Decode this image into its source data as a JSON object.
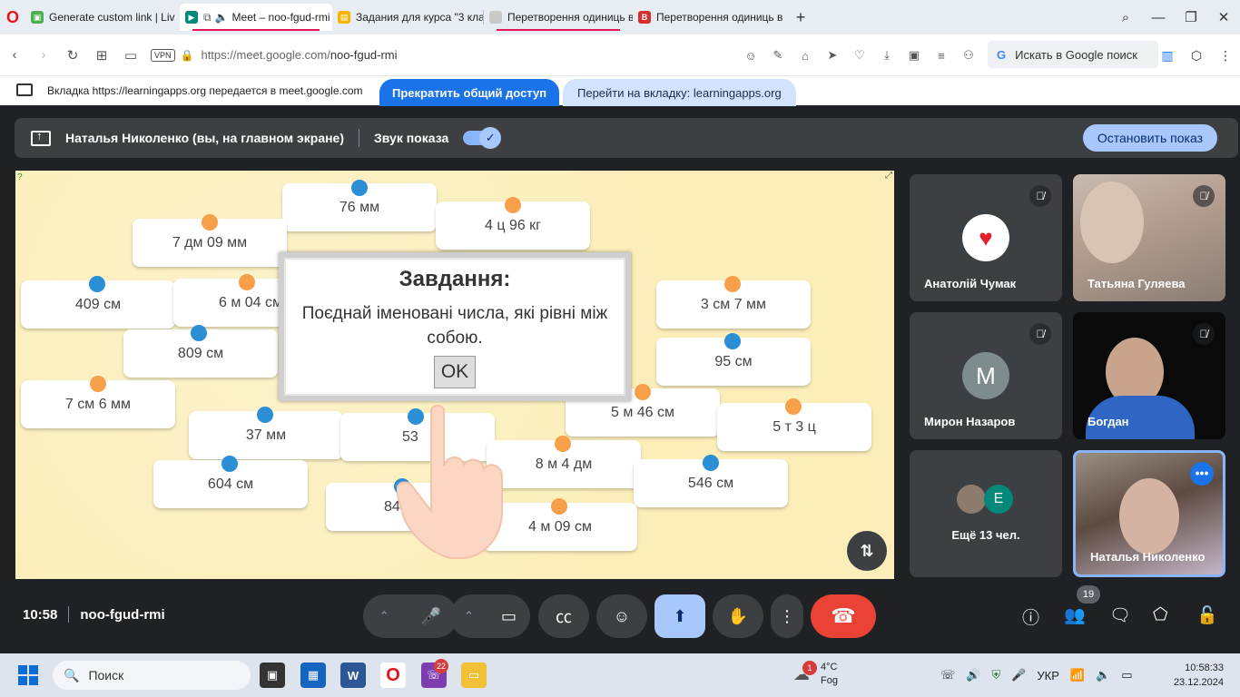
{
  "browser": {
    "tabs": [
      {
        "title": "Generate custom link | Liv",
        "favicon_color": "#4caf50"
      },
      {
        "title": "Meet – noo-fgud-rmi",
        "favicon_color": "#00897b",
        "active": true
      },
      {
        "title": "Задания для курса \"3 кла",
        "favicon_color": "#f4b400"
      },
      {
        "title": "Перетворення одиниць в",
        "favicon_color": "#c9c9c9"
      },
      {
        "title": "Перетворення одиниць в",
        "favicon_color": "#d32f2f",
        "favicon_letter": "B"
      }
    ],
    "new_tab": "+",
    "vpn": "VPN",
    "url_host": "https://meet.google.com/",
    "url_path": "noo-fgud-rmi",
    "search_placeholder": "Искать в Google поиск",
    "search_g": "G"
  },
  "share_bar": {
    "message": "Вкладка https://learningapps.org передается в meet.google.com",
    "stop_button": "Прекратить общий доступ",
    "goto_button": "Перейти на вкладку: learningapps.org"
  },
  "presenter": {
    "name": "Наталья Николенко (вы, на главном экране)",
    "sound_label": "Звук показа",
    "toggle_mark": "✓",
    "stop_button": "Остановить показ"
  },
  "stage": {
    "cards": [
      {
        "label": "76 мм",
        "dot": "b"
      },
      {
        "label": "4 ц 96 кг",
        "dot": "o"
      },
      {
        "label": "7 дм 09 мм",
        "dot": "o"
      },
      {
        "label": "409 см",
        "dot": "b"
      },
      {
        "label": "6 м 04 см",
        "dot": "o"
      },
      {
        "label": "3 см 7 мм",
        "dot": "o"
      },
      {
        "label": "809 см",
        "dot": "b"
      },
      {
        "label": "95 см",
        "dot": "b"
      },
      {
        "label": "7 см 6 мм",
        "dot": "o"
      },
      {
        "label": "5 м 46 см",
        "dot": "o"
      },
      {
        "label": "5 т 3 ц",
        "dot": "o"
      },
      {
        "label": "37 мм",
        "dot": "b"
      },
      {
        "label": "53",
        "dot": "b"
      },
      {
        "label": "8 м 4 дм",
        "dot": "o"
      },
      {
        "label": "604 см",
        "dot": "b"
      },
      {
        "label": "546 см",
        "dot": "b"
      },
      {
        "label": "84 дм",
        "dot": "b"
      },
      {
        "label": "4 м 09 см",
        "dot": "o"
      }
    ],
    "dialog_title": "Завдання:",
    "dialog_text": "Поєднай іменовані числа, які рівні між собою.",
    "dialog_ok": "OK",
    "swap_icon": "⇅"
  },
  "participants": [
    {
      "name": "Анатолій Чумак",
      "muted": true,
      "avatar": "heart"
    },
    {
      "name": "Татьяна Гуляева",
      "muted": true,
      "avatar": "video"
    },
    {
      "name": "Мирон Назаров",
      "muted": true,
      "avatar": "M"
    },
    {
      "name": "Богдан",
      "muted": true,
      "avatar": "video"
    },
    {
      "name": "Ещё 13 чел.",
      "avatar": "group",
      "group_letter": "E"
    },
    {
      "name": "Наталья Николенко",
      "avatar": "video"
    }
  ],
  "mute_icon": "🎙̸",
  "more_icon": "•••",
  "bottom": {
    "time": "10:58",
    "meeting_code": "noo-fgud-rmi",
    "participants_count": "19",
    "hangup_icon": "☎"
  },
  "taskbar": {
    "search_label": "Поиск",
    "viber_badge": "22",
    "weather_badge": "1",
    "temperature": "4°C",
    "weather": "Fog",
    "language": "УКР",
    "clock_time": "10:58:33",
    "clock_date": "23.12.2024"
  }
}
